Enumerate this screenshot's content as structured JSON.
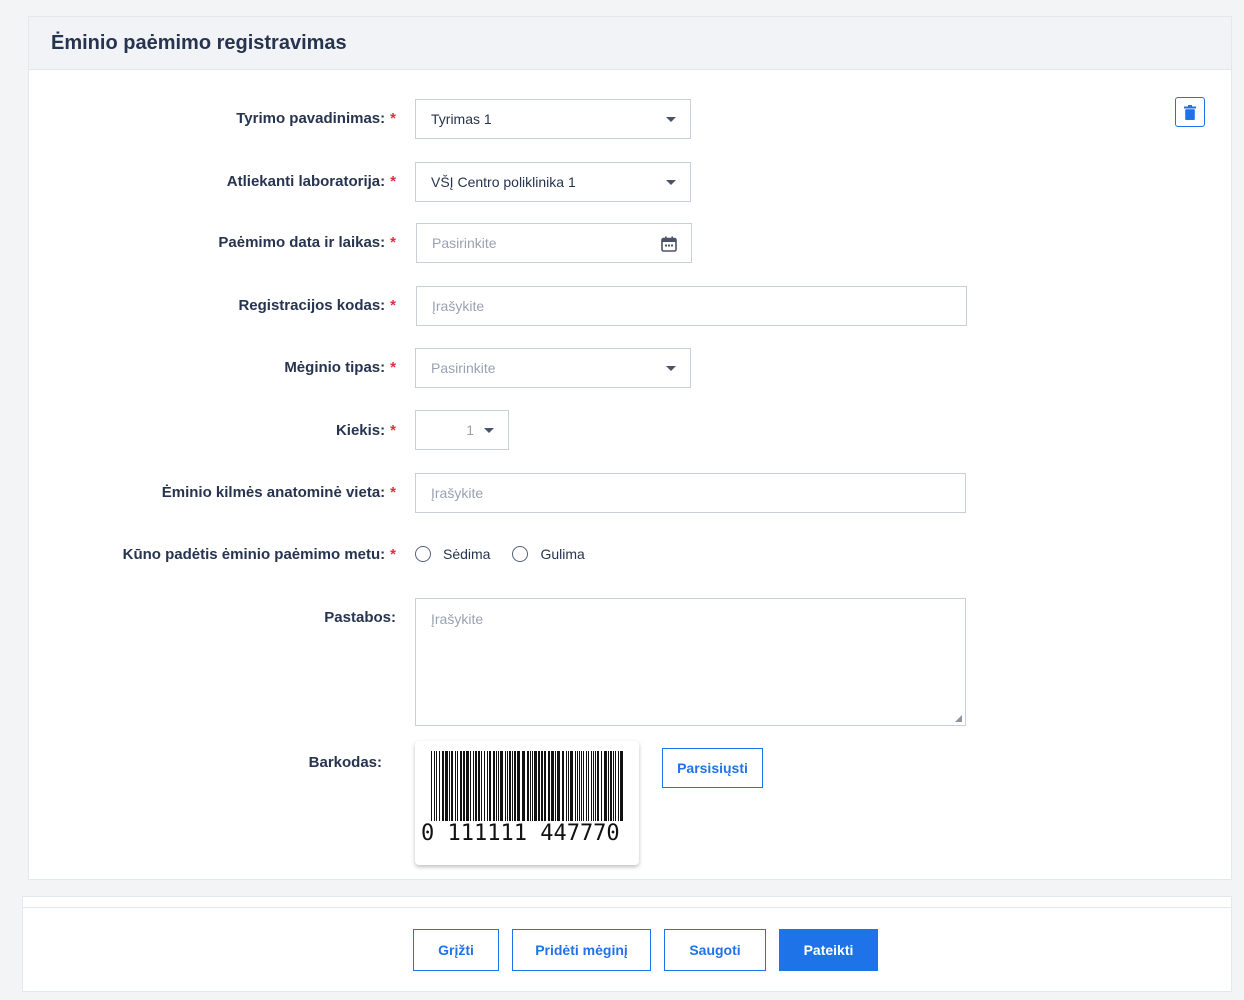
{
  "header": {
    "title": "Ėminio paėmimo registravimas"
  },
  "form": {
    "test_name": {
      "label": "Tyrimo pavadinimas:",
      "value": "Tyrimas 1"
    },
    "laboratory": {
      "label": "Atliekanti laboratorija:",
      "value": "VŠĮ Centro poliklinika 1"
    },
    "date_time": {
      "label": "Paėmimo data ir laikas:",
      "placeholder": "Pasirinkite"
    },
    "reg_code": {
      "label": "Registracijos kodas:",
      "placeholder": "Įrašykite"
    },
    "sample_type": {
      "label": "Mėginio tipas:",
      "placeholder": "Pasirinkite"
    },
    "quantity": {
      "label": "Kiekis:",
      "value": "1"
    },
    "anatomic_site": {
      "label": "Ėminio kilmės anatominė vieta:",
      "placeholder": "Įrašykite"
    },
    "body_position": {
      "label": "Kūno padėtis ėminio paėmimo metu:",
      "options": [
        "Sėdima",
        "Gulima"
      ]
    },
    "notes": {
      "label": "Pastabos:",
      "placeholder": "Įrašykite"
    },
    "barcode": {
      "label": "Barkodas:",
      "digits": "0 111111 447770",
      "download_label": "Parsisiųsti"
    },
    "required_mark": "*"
  },
  "footer": {
    "back_label": "Grįžti",
    "add_sample_label": "Pridėti mėginį",
    "save_label": "Saugoti",
    "submit_label": "Pateikti"
  },
  "colors": {
    "accent": "#1f73e8",
    "required": "#d93040",
    "text": "#27344f",
    "placeholder": "#9aa2b1"
  },
  "icons": {
    "delete": "trash-icon",
    "calendar": "calendar-icon"
  }
}
